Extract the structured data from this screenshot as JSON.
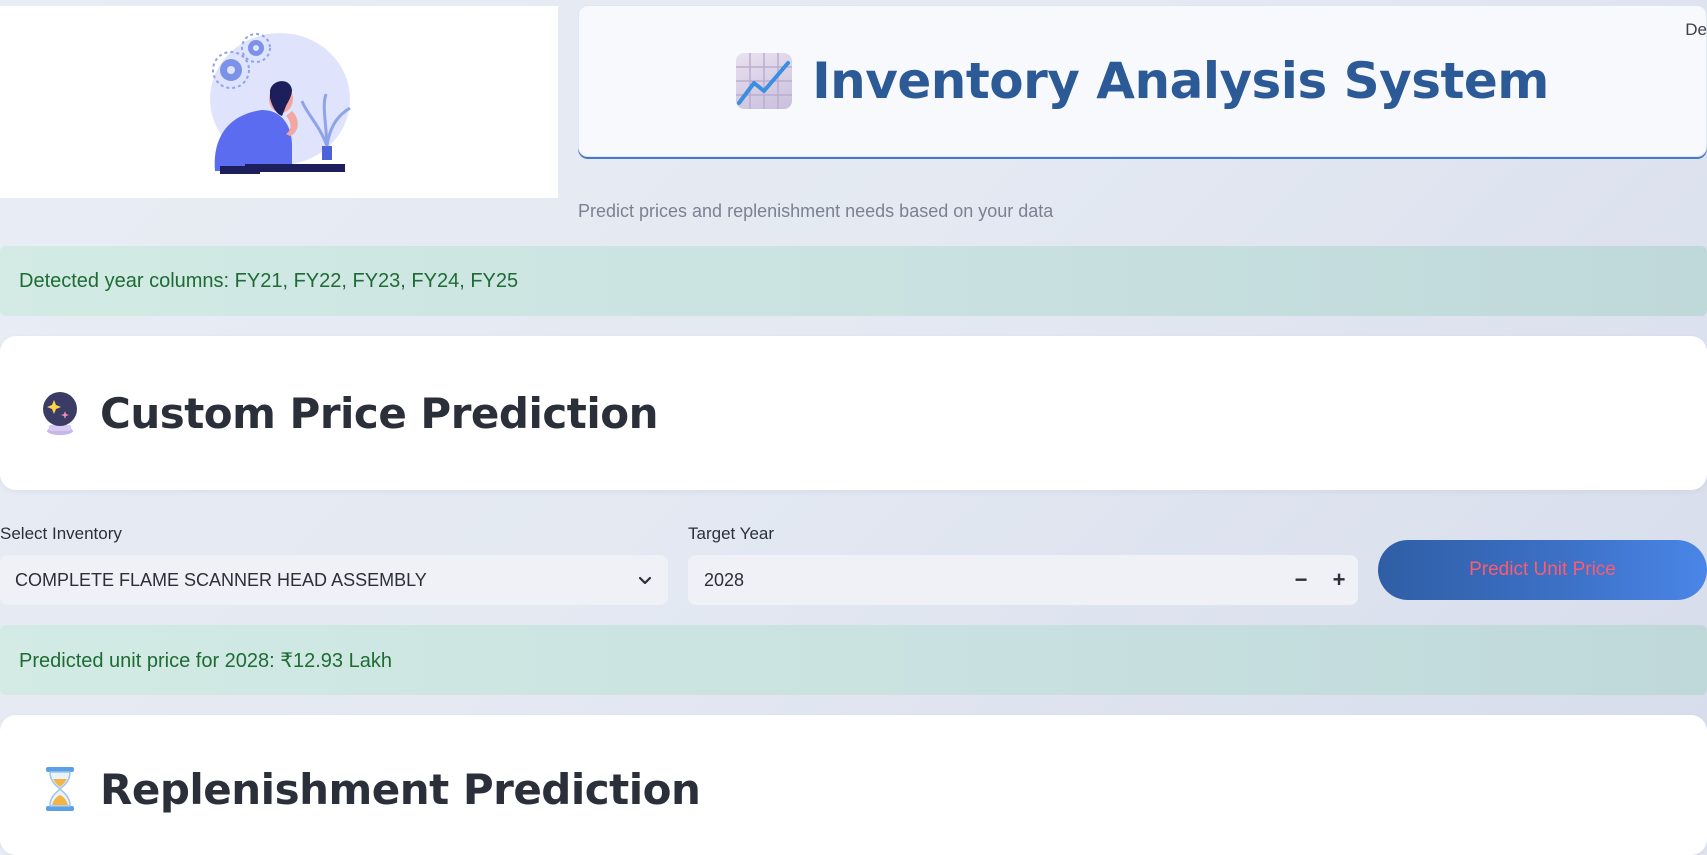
{
  "header": {
    "title": "Inventory Analysis System",
    "corner_text": "De",
    "subtitle": "Predict prices and replenishment needs based on your data"
  },
  "alerts": {
    "detected_years": "Detected year columns: FY21, FY22, FY23, FY24, FY25",
    "prediction_result": "Predicted unit price for 2028: ₹12.93 Lakh"
  },
  "sections": {
    "custom_price": "Custom Price Prediction",
    "replenishment": "Replenishment Prediction"
  },
  "form": {
    "inventory_label": "Select Inventory",
    "inventory_value": "COMPLETE FLAME SCANNER HEAD ASSEMBLY",
    "year_label": "Target Year",
    "year_value": "2028",
    "minus": "−",
    "plus": "+",
    "predict_button": "Predict Unit Price"
  },
  "colors": {
    "title_blue": "#2c5a97",
    "success_text": "#1e6b35",
    "button_text": "#ff5a6e",
    "button_bg_start": "#2f5ea5",
    "button_bg_end": "#4a86e8"
  },
  "icons": {
    "illustration": "person-thinking-with-gears-illustration",
    "title_icon": "chart-increasing-icon",
    "section1_icon": "crystal-ball-icon",
    "section2_icon": "hourglass-icon",
    "select_icon": "chevron-down-icon"
  }
}
